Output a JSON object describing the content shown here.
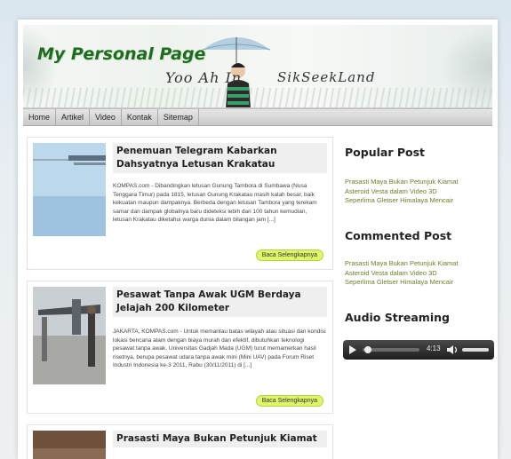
{
  "header": {
    "site_title": "My Personal Page",
    "tagline_left": "Yoo Ah In",
    "tagline_right": "SikSeekLand"
  },
  "nav": {
    "items": [
      "Home",
      "Artikel",
      "Video",
      "Kontak",
      "Sitemap"
    ]
  },
  "posts": [
    {
      "title": "Penemuan Telegram Kabarkan Dahsyatnya Letusan Krakatau",
      "excerpt": "KOMPAS.com - Dibandingkan letusan Gunung Tambora di Sumbawa (Nusa Tenggara Timur) pada 1815, letusan Gunung Krakatau masih kalah besar, baik kekuatan maupun dampaknya. Berbeda dengan letusan Tambora yang terekam samar dan dampak globalnya baru dideteksi lebih dari 100 tahun kemudian, letusan Krakatau diketahui warga dunia dalam bilangan jam [...]",
      "more_label": "Baca Selengkapnya"
    },
    {
      "title": "Pesawat Tanpa Awak UGM Berdaya Jelajah 200 Kilometer",
      "excerpt": "JAKARTA, KOMPAS.com - Untuk memantau batas wilayah atau situasi dan kondisi lokasi bencana alam dengan biaya murah dan efektif, dibutuhkan teknologi pesawat tanpa awak. Universitas Gadjah Mada (UGM) turut memamerkan hasil risetnya, berupa pesawat udara tanpa awak mini (Mini UAV) pada Forum Riset Industri Indonesia ke-3 2011, Rabu (30/11/2011) di [...]",
      "more_label": "Baca Selengkapnya"
    },
    {
      "title": "Prasasti Maya Bukan Petunjuk Kiamat"
    }
  ],
  "sidebar": {
    "popular": {
      "heading": "Popular Post",
      "links": [
        "Prasasti Maya Bukan Petunjuk Kiamat",
        "Asteroid Vesta dalam Video 3D",
        "Seperlima Gletser Himalaya Mencair"
      ]
    },
    "commented": {
      "heading": "Commented Post",
      "links": [
        "Prasasti Maya Bukan Petunjuk Kiamat",
        "Asteroid Vesta dalam Video 3D",
        "Seperlima Gletser Himalaya Mencair"
      ]
    },
    "audio": {
      "heading": "Audio Streaming",
      "time": "4:13",
      "progress": 0.1
    }
  },
  "colors": {
    "title_green": "#1f6b1f",
    "link_green": "#6a7f2a",
    "button_lime": "#dff56a"
  }
}
